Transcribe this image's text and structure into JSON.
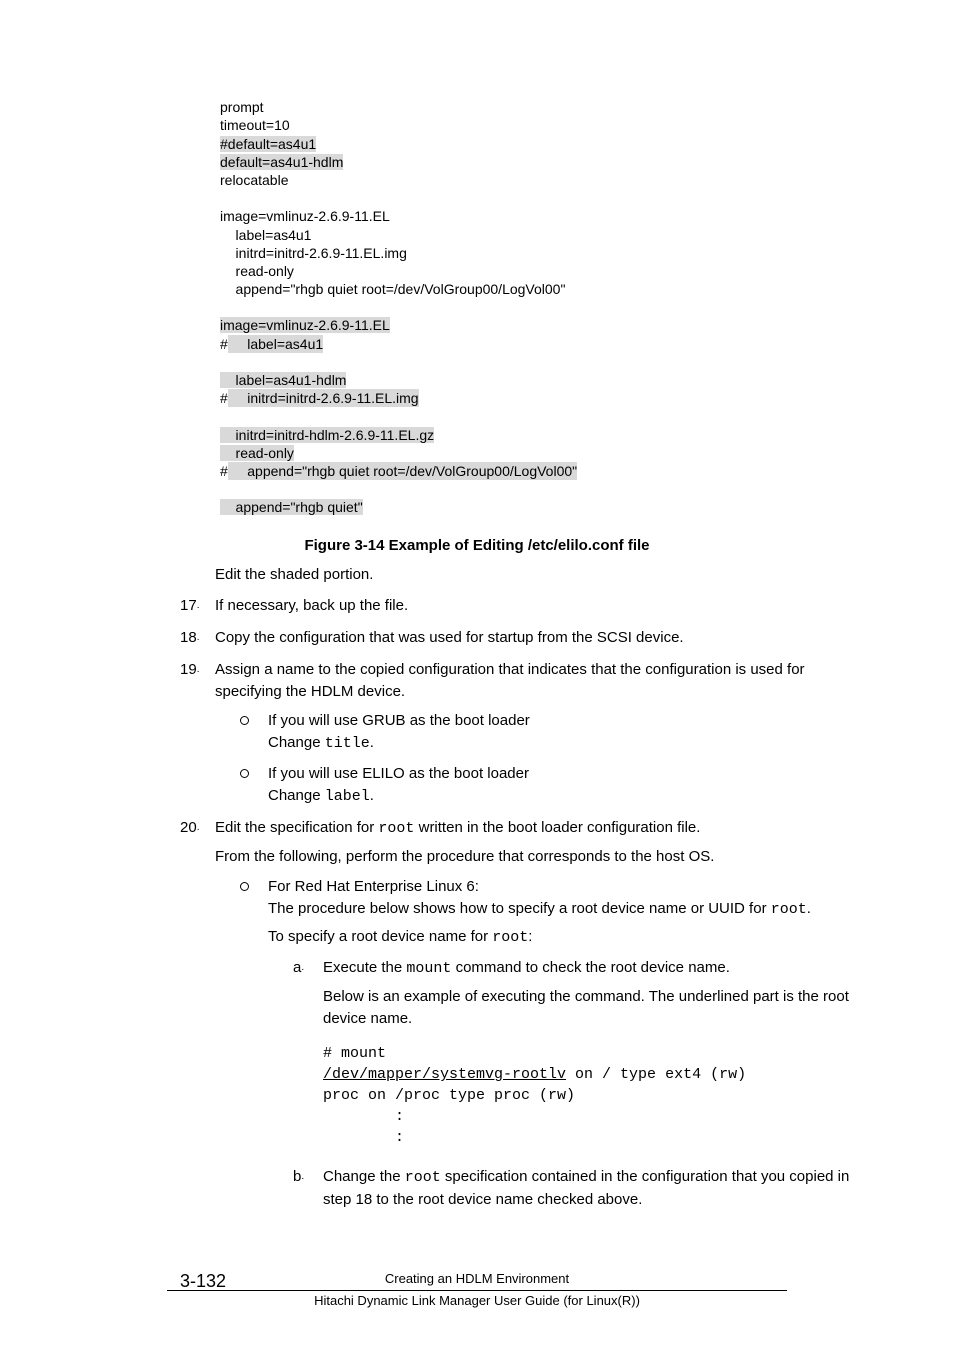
{
  "code": {
    "l1": "prompt",
    "l2": "timeout=10",
    "l3": "#default=as4u1",
    "l4": "default=as4u1-hdlm",
    "l5": "relocatable",
    "l6": "image=vmlinuz-2.6.9-11.EL",
    "l7": "    label=as4u1",
    "l8": "    initrd=initrd-2.6.9-11.EL.img",
    "l9": "    read-only",
    "l10": "    append=\"rhgb quiet root=/dev/VolGroup00/LogVol00\"",
    "l11": "image=vmlinuz-2.6.9-11.EL",
    "l12a": "#",
    "l12b": "     label=as4u1",
    "l13": "    label=as4u1-hdlm",
    "l14a": "#",
    "l14b": "     initrd=initrd-2.6.9-11.EL.img",
    "l15": "    initrd=initrd-hdlm-2.6.9-11.EL.gz",
    "l16": "    read-only",
    "l17a": "#",
    "l17b": "     append=\"rhgb quiet root=/dev/VolGroup00/LogVol00\"",
    "l18": "    append=\"rhgb quiet\""
  },
  "figure_caption": "Figure 3-14 Example of Editing /etc/elilo.conf file",
  "edit_shaded": "Edit the shaded portion.",
  "items": {
    "n17": "17",
    "t17": "If necessary, back up the file.",
    "n18": "18",
    "t18": "Copy the configuration that was used for startup from the SCSI device.",
    "n19": "19",
    "t19": "Assign a name to the copied configuration that indicates that the configuration is used for specifying the HDLM device.",
    "b19a_1": "If you will use GRUB as the boot loader",
    "b19a_2a": "Change ",
    "b19a_2b": "title",
    "b19a_2c": ".",
    "b19b_1": "If you will use ELILO as the boot loader",
    "b19b_2a": "Change ",
    "b19b_2b": "label",
    "b19b_2c": ".",
    "n20": "20",
    "t20a": "Edit the specification for ",
    "t20b": "root",
    "t20c": " written in the boot loader configuration file.",
    "t20p2": "From the following, perform the procedure that corresponds to the host OS.",
    "b20_1": "For Red Hat Enterprise Linux 6:",
    "b20_2a": "The procedure below shows how to specify a root device name or UUID for ",
    "b20_2b": "root",
    "b20_2c": ".",
    "b20_3a": "To specify a root device name for ",
    "b20_3b": "root",
    "b20_3c": ":",
    "la": "a",
    "la_1a": "Execute the ",
    "la_1b": "mount",
    "la_1c": " command to check the root device name.",
    "la_2": "Below is an example of executing the command. The underlined part is the root device name.",
    "mount_l1": "# mount",
    "mount_l2u": "/dev/mapper/systemvg-rootlv",
    "mount_l2r": " on / type ext4 (rw)",
    "mount_l3": "proc on /proc type proc (rw)",
    "mount_l4": "        :",
    "mount_l5": "        :",
    "lb": "b",
    "lb_1a": "Change the ",
    "lb_1b": "root",
    "lb_1c": " specification contained in the configuration that you copied in step 18 to the root device name checked above."
  },
  "footer": {
    "page_num": "3-132",
    "title1": "Creating an HDLM Environment",
    "title2": "Hitachi Dynamic Link Manager User Guide (for Linux(R))"
  }
}
